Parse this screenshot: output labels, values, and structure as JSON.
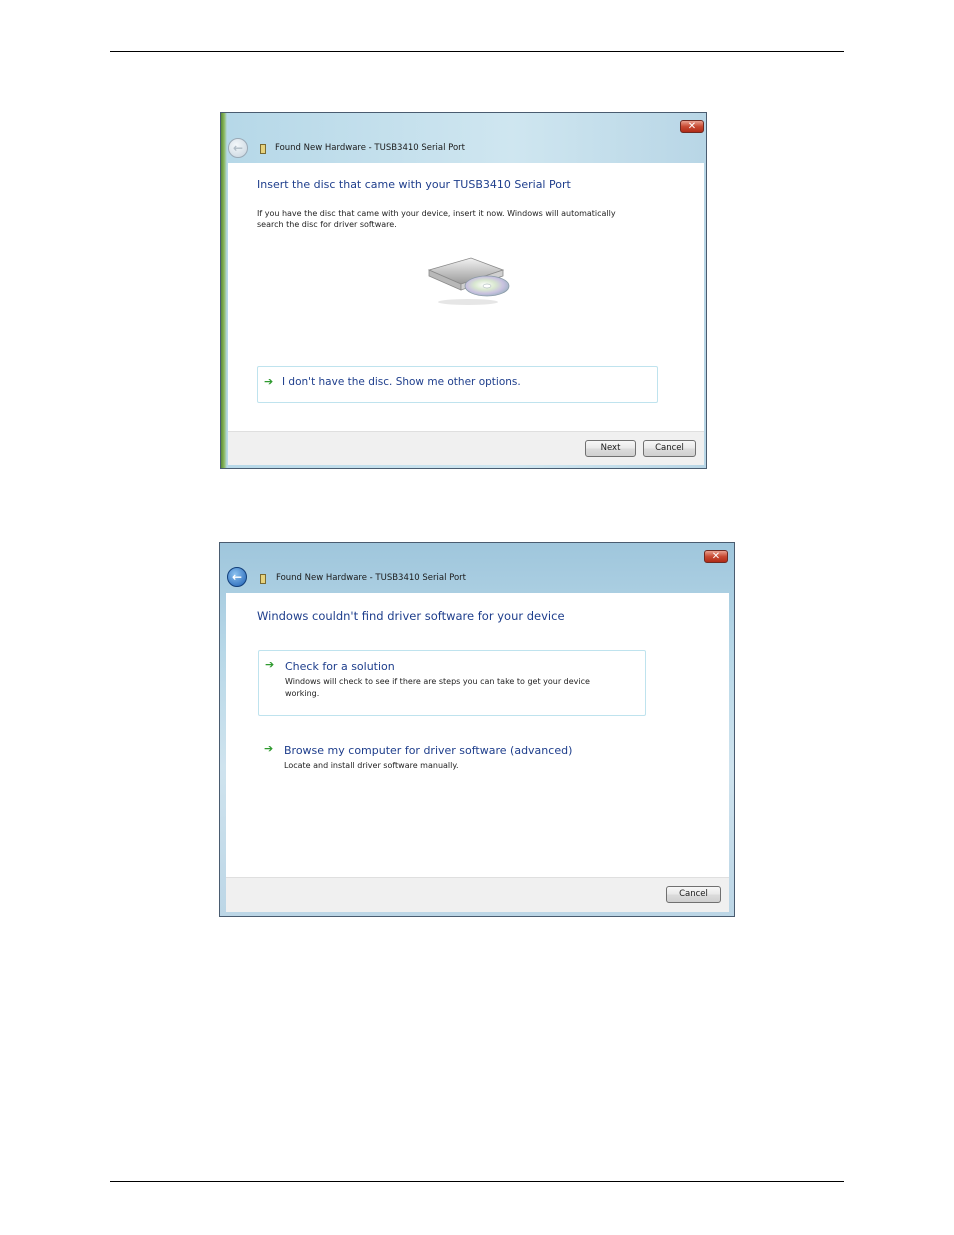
{
  "dialog1": {
    "title": "Found New Hardware - TUSB3410 Serial Port",
    "close_glyph": "✕",
    "back_glyph": "←",
    "heading": "Insert the disc that came with your TUSB3410 Serial Port",
    "body": "If you have the disc that came with your device, insert it now.  Windows will automatically search the disc for driver software.",
    "option": {
      "arrow": "➔",
      "label": "I don't have the disc.  Show me other options."
    },
    "buttons": {
      "next": "Next",
      "cancel": "Cancel"
    }
  },
  "dialog2": {
    "title": "Found New Hardware - TUSB3410 Serial Port",
    "close_glyph": "✕",
    "back_glyph": "←",
    "heading": "Windows couldn't find driver software for your device",
    "options": [
      {
        "arrow": "➔",
        "label": "Check for a solution",
        "description": "Windows will check to see if there are steps you can take to get your device working."
      },
      {
        "arrow": "➔",
        "label": "Browse my computer for driver software (advanced)",
        "description": "Locate and install driver software manually."
      }
    ],
    "buttons": {
      "cancel": "Cancel"
    }
  },
  "icons": {
    "back": "back-arrow-icon",
    "hardware": "hardware-device-icon",
    "close": "close-icon",
    "option_arrow": "green-arrow-icon",
    "disc_drive": "disc-drive-icon"
  },
  "colors": {
    "heading_blue": "#1e3e8c",
    "option_arrow_green": "#2f9a2f",
    "close_red": "#c84a33"
  }
}
